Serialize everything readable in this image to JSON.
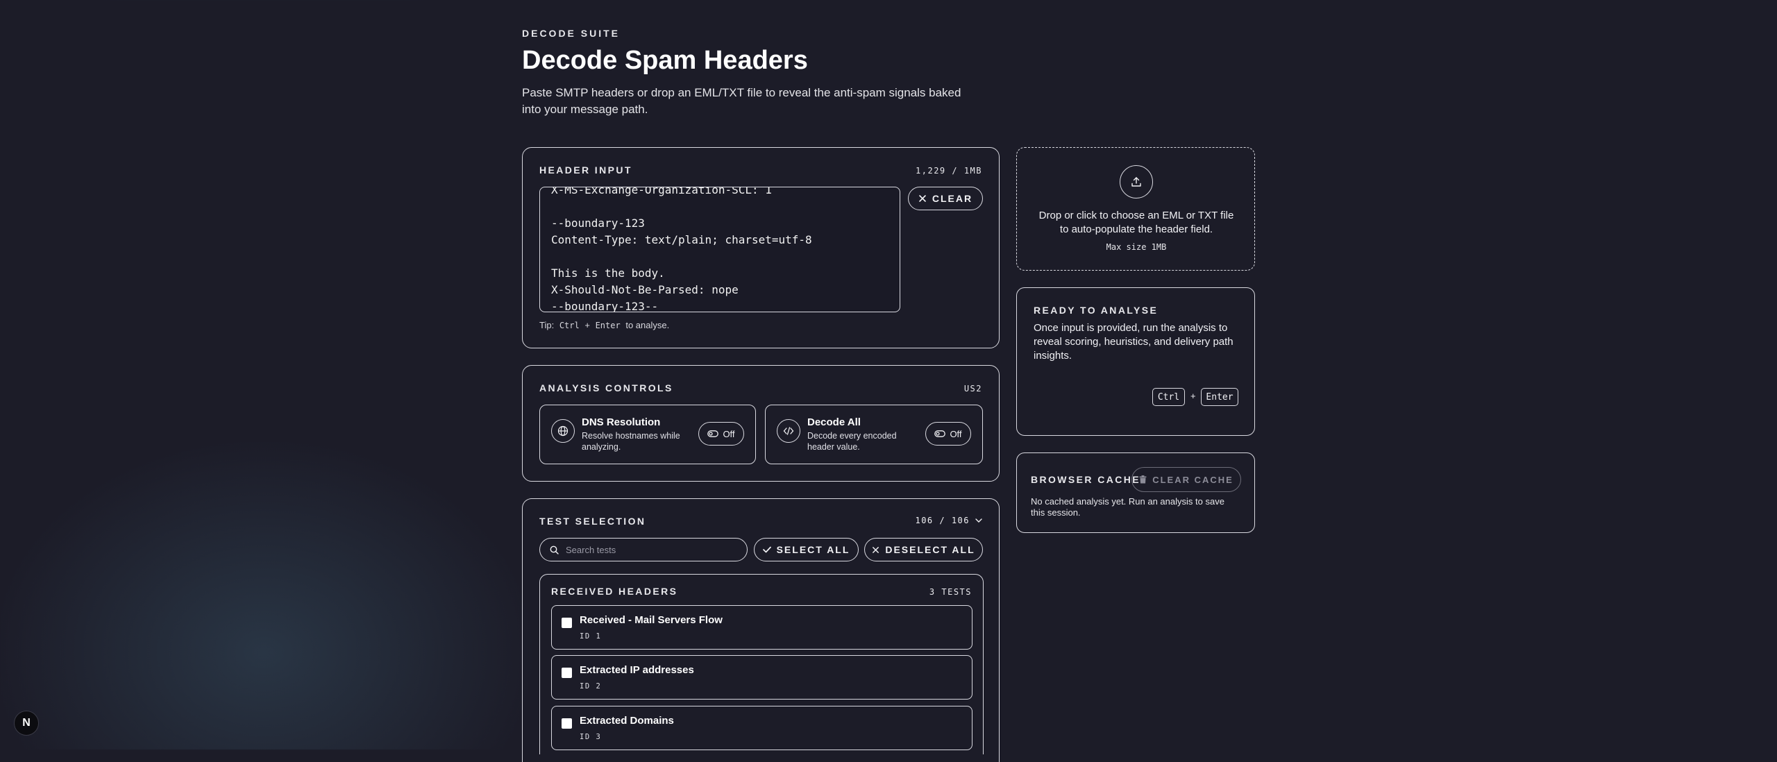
{
  "header": {
    "eyebrow": "DECODE SUITE",
    "title": "Decode Spam Headers",
    "subtitle": "Paste SMTP headers or drop an EML/TXT file to reveal the anti-spam signals baked into your message path."
  },
  "header_input": {
    "label": "HEADER INPUT",
    "size_counter": "1,229 / 1MB",
    "content": "X-MS-Exchange-Organization-SCL: 1\n\n--boundary-123\nContent-Type: text/plain; charset=utf-8\n\nThis is the body.\nX-Should-Not-Be-Parsed: nope\n--boundary-123--",
    "clear_label": "CLEAR",
    "tip_prefix": "Tip:",
    "tip_key1": "Ctrl",
    "tip_plus": "+",
    "tip_key2": "Enter",
    "tip_suffix": "to analyse."
  },
  "analysis_controls": {
    "label": "ANALYSIS CONTROLS",
    "meta": "US2",
    "dns": {
      "title": "DNS Resolution",
      "desc": "Resolve hostnames while analyzing.",
      "toggle": "Off",
      "icon": "globe-icon"
    },
    "decode": {
      "title": "Decode All",
      "desc": "Decode every encoded header value.",
      "toggle": "Off",
      "icon": "code-icon"
    }
  },
  "test_selection": {
    "label": "TEST SELECTION",
    "counter": "106 / 106",
    "search_placeholder": "Search tests",
    "select_all": "SELECT ALL",
    "deselect_all": "DESELECT ALL",
    "group": {
      "title": "RECEIVED HEADERS",
      "count": "3 TESTS",
      "tests": [
        {
          "name": "Received - Mail Servers Flow",
          "id": "ID 1",
          "checked": false
        },
        {
          "name": "Extracted IP addresses",
          "id": "ID 2",
          "checked": false
        },
        {
          "name": "Extracted Domains",
          "id": "ID 3",
          "checked": false
        }
      ]
    }
  },
  "upload": {
    "text": "Drop or click to choose an EML or TXT file to auto-populate the header field.",
    "max_size": "Max size 1MB",
    "icon": "upload-icon"
  },
  "ready": {
    "label": "READY TO ANALYSE",
    "text": "Once input is provided, run the analysis to reveal scoring, heuristics, and delivery path insights.",
    "key1": "Ctrl",
    "plus": "+",
    "key2": "Enter"
  },
  "cache": {
    "label": "BROWSER CACHE",
    "button": "CLEAR CACHE",
    "text": "No cached analysis yet. Run an analysis to save this session."
  },
  "next_badge": "N",
  "colors": {
    "background": "#1c1c28",
    "border": "#d9d9e0",
    "text": "#f2f2f5"
  }
}
